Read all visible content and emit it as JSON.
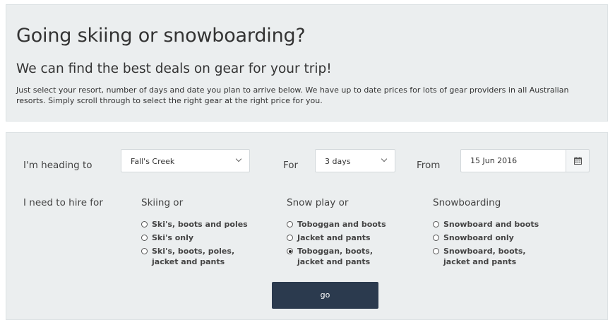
{
  "intro": {
    "title": "Going skiing or snowboarding?",
    "subtitle": "We can find the best deals on gear for your trip!",
    "description": "Just select your resort, number of days and date you plan to arrive below. We have up to date prices for lots of gear providers in all Australian resorts. Simply scroll through to select the right gear at the right price for you."
  },
  "form": {
    "heading_label": "I'm heading to",
    "resort": "Fall's Creek",
    "for_label": "For",
    "days": "3 days",
    "from_label": "From",
    "date": "15 Jun 2016",
    "hire_label": "I need to hire for",
    "calendar_icon": "calendar-icon",
    "groups": [
      {
        "title": "Skiing or",
        "options": [
          {
            "label": "Ski's, boots and poles",
            "checked": false
          },
          {
            "label": "Ski's only",
            "checked": false
          },
          {
            "label_line1": "Ski's, boots, poles,",
            "label_line2": "jacket and pants",
            "checked": false
          }
        ]
      },
      {
        "title": "Snow play or",
        "options": [
          {
            "label": "Toboggan and boots",
            "checked": false
          },
          {
            "label": "Jacket and pants",
            "checked": false
          },
          {
            "label_line1": "Toboggan, boots,",
            "label_line2": "jacket and pants",
            "checked": true
          }
        ]
      },
      {
        "title": "Snowboarding",
        "options": [
          {
            "label": "Snowboard and boots",
            "checked": false
          },
          {
            "label": "Snowboard only",
            "checked": false
          },
          {
            "label_line1": "Snowboard, boots,",
            "label_line2": "jacket and pants",
            "checked": false
          }
        ]
      }
    ],
    "submit_label": "go"
  },
  "colors": {
    "panel_bg": "#ebeeef",
    "button_bg": "#2b3a4e",
    "button_text": "#ffffff"
  }
}
